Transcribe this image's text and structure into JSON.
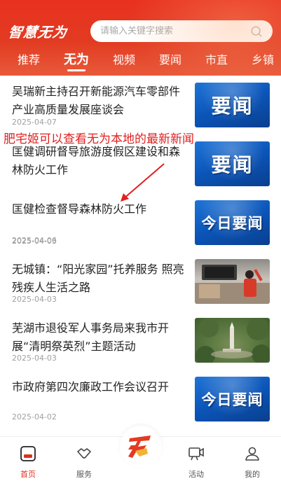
{
  "header": {
    "logo": "智慧无为",
    "search_placeholder": "请输入关键字搜索",
    "tabs": [
      "推荐",
      "无为",
      "视频",
      "要闻",
      "市直",
      "乡镇"
    ],
    "active_tab": "无为"
  },
  "annotation": "肥宅姬可以查看无为本地的最新新闻",
  "news": [
    {
      "title": "吴瑞新主持召开新能源汽车零部件产业高质量发展座谈会",
      "date": "2025-04-07",
      "thumb_text": "要闻"
    },
    {
      "title": "匡健调研督导旅游度假区建设和森林防火工作",
      "date": "2025-04-06",
      "thumb_text": "要闻"
    },
    {
      "title": "匡健检查督导森林防火工作",
      "date": "2025-04-03",
      "thumb_text": "今日要闻"
    },
    {
      "title": "无城镇：“阳光家园”托养服务 照亮残疾人生活之路",
      "date": "2025-04-03",
      "thumb_text": ""
    },
    {
      "title": "芜湖市退役军人事务局来我市开展“清明祭英烈”主题活动",
      "date": "2025-04-03",
      "thumb_text": ""
    },
    {
      "title": "市政府第四次廉政工作会议召开",
      "date": "2025-04-02",
      "thumb_text": "今日要闻"
    }
  ],
  "bottom_nav": [
    {
      "label": "首页",
      "icon": "home-icon",
      "active": true
    },
    {
      "label": "服务",
      "icon": "handshake-icon",
      "active": false
    },
    {
      "label": "",
      "icon": "wuwei-logo-icon",
      "active": false
    },
    {
      "label": "活动",
      "icon": "video-board-icon",
      "active": false
    },
    {
      "label": "我的",
      "icon": "user-icon",
      "active": false
    }
  ],
  "colors": {
    "brand": "#e23b22",
    "annotation": "#e02020",
    "thumb_blue": "#0b55b8"
  }
}
